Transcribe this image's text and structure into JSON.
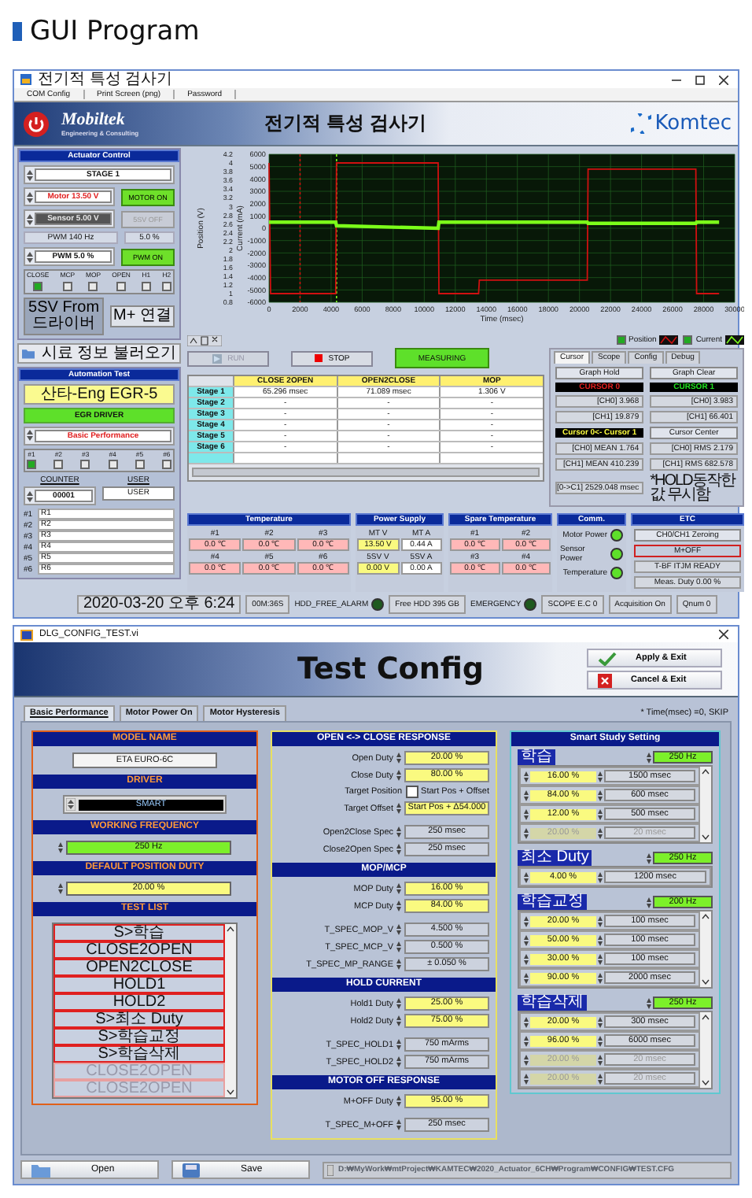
{
  "page_title": "GUI Program",
  "main_window": {
    "title": "전기적 특성 검사기",
    "menu": [
      "COM Config",
      "Print Screen (png)",
      "Password"
    ],
    "brand": {
      "name": "Mobiltek",
      "tagline": "Engineering & Consulting"
    },
    "heading": "전기적 특성 검사기",
    "partner_logo": "Komtec",
    "actuator_control": {
      "title": "Actuator Control",
      "stage": "STAGE 1",
      "switches": [
        {
          "value": "Motor 13.50 V",
          "button": "MOTOR ON",
          "on": true
        },
        {
          "value": "Sensor  5.00 V",
          "button": "5SV OFF",
          "on": false
        }
      ],
      "pwm_frequency": "PWM 140 Hz",
      "pwm_duty": "5.0 %",
      "pwm": {
        "value": "PWM 5.0 %",
        "button": "PWM ON",
        "on": true
      },
      "checks": [
        {
          "label": "CLOSE",
          "checked": true
        },
        {
          "label": "MCP",
          "checked": false
        },
        {
          "label": "MOP",
          "checked": false
        },
        {
          "label": "OPEN",
          "checked": false
        },
        {
          "label": "H1",
          "checked": false
        },
        {
          "label": "H2",
          "checked": false
        }
      ],
      "buttons": [
        "5SV From 드라이버",
        "M+ 연결"
      ]
    },
    "load_button": "시료 정보 불러오기",
    "automation_test": {
      "title": "Automation Test",
      "model": "산타-Eng EGR-5",
      "driver": "EGR DRIVER",
      "mode": "Basic Performance",
      "channels": [
        {
          "label": "#1",
          "checked": true
        },
        {
          "label": "#2",
          "checked": false
        },
        {
          "label": "#3",
          "checked": false
        },
        {
          "label": "#4",
          "checked": false
        },
        {
          "label": "#5",
          "checked": false
        },
        {
          "label": "#6",
          "checked": false
        }
      ],
      "counter": {
        "label": "COUNTER",
        "value": "00001"
      },
      "user": {
        "label": "USER",
        "value": "USER"
      },
      "results": [
        {
          "label": "#1",
          "value": "R1"
        },
        {
          "label": "#2",
          "value": "R2"
        },
        {
          "label": "#3",
          "value": "R3"
        },
        {
          "label": "#4",
          "value": "R4"
        },
        {
          "label": "#5",
          "value": "R5"
        },
        {
          "label": "#6",
          "value": "R6"
        }
      ]
    },
    "chart": {
      "position_axis": {
        "label": "Position (V)",
        "ticks": [
          "4.2",
          "4",
          "3.8",
          "3.6",
          "3.4",
          "3.2",
          "3",
          "2.8",
          "2.6",
          "2.4",
          "2.2",
          "2",
          "1.8",
          "1.6",
          "1.4",
          "1.2",
          "1",
          "0.8"
        ]
      },
      "chart_data": {
        "type": "line",
        "xlabel": "Time (msec)",
        "ylabel": "Current (mA)",
        "x": [
          0,
          100,
          4300,
          4350,
          10900,
          10950,
          13500,
          13550,
          20500,
          20550,
          27500,
          27550,
          29000
        ],
        "series": [
          {
            "name": "Position",
            "color": "#d01010",
            "values": [
              5300,
              -5300,
              -5300,
              5300,
              5300,
              -5300,
              -5300,
              -4200,
              -4200,
              4800,
              4800,
              -5300,
              -5300
            ]
          },
          {
            "name": "Current",
            "color": "#7cff1a",
            "values": [
              500,
              500,
              500,
              200,
              0,
              500,
              500,
              500,
              500,
              400,
              400,
              500,
              500
            ]
          }
        ],
        "xlim": [
          0,
          30000
        ],
        "ylim": [
          -6000,
          6000
        ],
        "xticks": [
          0,
          2000,
          4000,
          6000,
          8000,
          10000,
          12000,
          14000,
          16000,
          18000,
          20000,
          22000,
          24000,
          26000,
          28000,
          30000
        ],
        "yticks": [
          -6000,
          -5000,
          -4000,
          -3000,
          -2000,
          -1000,
          0,
          1000,
          2000,
          3000,
          4000,
          5000,
          6000
        ],
        "grid": true,
        "ref_lines": [
          {
            "axis": "x",
            "value": 2000,
            "color": "#d01010"
          },
          {
            "axis": "x",
            "value": 4350,
            "color": "#7cff1a"
          }
        ]
      },
      "legend": [
        {
          "checked": true
        },
        {
          "checked": true
        }
      ]
    },
    "controls": [
      {
        "label": "RUN",
        "kind": "run",
        "disabled": true
      },
      {
        "label": "STOP",
        "kind": "stop",
        "disabled": false
      },
      {
        "label": "MEASURING",
        "kind": "status",
        "disabled": false
      }
    ],
    "results_table": {
      "columns": [
        "CLOSE 2OPEN",
        "OPEN2CLOSE",
        "MOP"
      ],
      "rows": [
        {
          "stage": "Stage 1",
          "cells": [
            "65.296 msec",
            "71.089 msec",
            "1.306 V"
          ]
        },
        {
          "stage": "Stage 2",
          "cells": [
            "-",
            "-",
            "-"
          ]
        },
        {
          "stage": "Stage 3",
          "cells": [
            "-",
            "-",
            "-"
          ]
        },
        {
          "stage": "Stage 4",
          "cells": [
            "-",
            "-",
            "-"
          ]
        },
        {
          "stage": "Stage 5",
          "cells": [
            "-",
            "-",
            "-"
          ]
        },
        {
          "stage": "Stage 6",
          "cells": [
            "-",
            "-",
            "-"
          ]
        }
      ]
    },
    "cursor_panel": {
      "tabs": [
        {
          "label": "Cursor",
          "selected": true
        },
        {
          "label": "Scope",
          "selected": false
        },
        {
          "label": "Config",
          "selected": false
        },
        {
          "label": "Debug",
          "selected": false
        }
      ],
      "items": [
        {
          "text": "Graph Hold",
          "kind": "button"
        },
        {
          "text": "Graph Clear",
          "kind": "button"
        },
        {
          "text": "CURSOR 0",
          "kind": "cursor0"
        },
        {
          "text": "CURSOR 1",
          "kind": "cursor1"
        },
        {
          "text": "[CH0] 3.968",
          "kind": "readout"
        },
        {
          "text": "[CH0] 3.983",
          "kind": "readout"
        },
        {
          "text": "[CH1] 19.879",
          "kind": "readout"
        },
        {
          "text": "[CH1] 66.401",
          "kind": "readout"
        },
        {
          "text": "Cursor 0<- Cursor 1",
          "kind": "marker"
        },
        {
          "text": "Cursor Center",
          "kind": "button"
        },
        {
          "text": "[CH0] MEAN 1.764",
          "kind": "readout"
        },
        {
          "text": "[CH0] RMS 2.179",
          "kind": "readout"
        },
        {
          "text": "[CH1] MEAN 410.239",
          "kind": "readout"
        },
        {
          "text": "[CH1] RMS 682.578",
          "kind": "readout"
        },
        {
          "text": "[0->C1] 2529.048 msec",
          "kind": "readout"
        },
        {
          "text": "*HOLD동작한 값 무시함",
          "kind": "note"
        }
      ]
    },
    "temperature": {
      "title": "Temperature",
      "cells": [
        {
          "label": "#1",
          "value": "0.0 ℃"
        },
        {
          "label": "#2",
          "value": "0.0 ℃"
        },
        {
          "label": "#3",
          "value": "0.0 ℃"
        },
        {
          "label": "#4",
          "value": "0.0 ℃"
        },
        {
          "label": "#5",
          "value": "0.0 ℃"
        },
        {
          "label": "#6",
          "value": "0.0 ℃"
        }
      ]
    },
    "power_supply": {
      "title": "Power Supply",
      "cells": [
        {
          "label": "MT V",
          "value": "13.50 V",
          "kind": "voltage"
        },
        {
          "label": "MT A",
          "value": "0.44 A",
          "kind": "current"
        },
        {
          "label": "5SV V",
          "value": "0.00 V",
          "kind": "voltage"
        },
        {
          "label": "5SV A",
          "value": "0.00 A",
          "kind": "current"
        }
      ]
    },
    "spare_temperature": {
      "title": "Spare Temperature",
      "cells": [
        {
          "label": "#1",
          "value": "0.0 ℃"
        },
        {
          "label": "#2",
          "value": "0.0 ℃"
        },
        {
          "label": "#3",
          "value": "0.0 ℃"
        },
        {
          "label": "#4",
          "value": "0.0 ℃"
        }
      ]
    },
    "comm": {
      "title": "Comm.",
      "items": [
        {
          "label": "Motor Power",
          "on": true
        },
        {
          "label": "Sensor Power",
          "on": true
        },
        {
          "label": "Temperature",
          "on": true
        }
      ]
    },
    "etc": {
      "title": "ETC",
      "items": [
        {
          "text": "CH0/CH1 Zeroing",
          "kind": "button"
        },
        {
          "text": "M+OFF",
          "kind": "alert"
        },
        {
          "text": "T-BF ITJM READY",
          "kind": "status"
        },
        {
          "text": "Meas. Duty 0.00 %",
          "kind": "status"
        }
      ]
    },
    "status_bar": [
      {
        "text": "2020-03-20 오후 6:24",
        "kind": "field"
      },
      {
        "text": "00M:36S",
        "kind": "field"
      },
      {
        "text": "HDD_FREE_ALARM",
        "kind": "led",
        "on": false
      },
      {
        "text": "Free HDD 395 GB",
        "kind": "field"
      },
      {
        "text": "EMERGENCY",
        "kind": "led",
        "on": false
      },
      {
        "text": "SCOPE E.C 0",
        "kind": "field"
      },
      {
        "text": "Acquisition On",
        "kind": "field"
      },
      {
        "text": "Qnum 0",
        "kind": "field"
      }
    ]
  },
  "config_window": {
    "title": "DLG_CONFIG_TEST.vi",
    "heading": "Test Config",
    "actions": [
      {
        "label": "Apply & Exit",
        "kind": "apply"
      },
      {
        "label": "Cancel & Exit",
        "kind": "cancel"
      }
    ],
    "tabs": [
      {
        "label": "Basic Performance",
        "selected": true
      },
      {
        "label": "Motor Power On",
        "selected": false
      },
      {
        "label": "Motor Hysteresis",
        "selected": false
      }
    ],
    "note": "* Time(msec) =0, SKIP",
    "settings": [
      {
        "title": "MODEL NAME",
        "kind": "text",
        "value": "ETA EURO-6C"
      },
      {
        "title": "DRIVER",
        "kind": "ring",
        "value": "SMART"
      },
      {
        "title": "WORKING FREQUENCY",
        "kind": "frequency",
        "value": "250 Hz"
      },
      {
        "title": "DEFAULT POSITION DUTY",
        "kind": "duty",
        "value": "20.00 %"
      }
    ],
    "test_list": {
      "title": "TEST LIST",
      "items": [
        {
          "label": "S>학습",
          "enabled": true
        },
        {
          "label": "CLOSE2OPEN",
          "enabled": true
        },
        {
          "label": "OPEN2CLOSE",
          "enabled": true
        },
        {
          "label": "HOLD1",
          "enabled": true
        },
        {
          "label": "HOLD2",
          "enabled": true
        },
        {
          "label": "S>최소 Duty",
          "enabled": true
        },
        {
          "label": "S>학습교정",
          "enabled": true
        },
        {
          "label": "S>학습삭제",
          "enabled": true
        },
        {
          "label": "CLOSE2OPEN",
          "enabled": false
        },
        {
          "label": "CLOSE2OPEN",
          "enabled": false
        }
      ]
    },
    "response_sections": [
      {
        "title": "OPEN <-> CLOSE RESPONSE",
        "rows": [
          {
            "label": "Open Duty",
            "value": "20.00 %",
            "kind": "duty"
          },
          {
            "label": "Close Duty",
            "value": "80.00 %",
            "kind": "duty"
          },
          {
            "label": "Target Position",
            "value": "Start Pos + Offset",
            "kind": "checkbox",
            "checked": false
          },
          {
            "label": "Target Offset",
            "value": "Start Pos + Δ54.000",
            "kind": "duty"
          },
          {
            "label": "Open2Close Spec",
            "value": "250 msec",
            "kind": "spec"
          },
          {
            "label": "Close2Open Spec",
            "value": "250 msec",
            "kind": "spec"
          }
        ]
      },
      {
        "title": "MOP/MCP",
        "rows": [
          {
            "label": "MOP Duty",
            "value": "16.00 %",
            "kind": "duty"
          },
          {
            "label": "MCP Duty",
            "value": "84.00 %",
            "kind": "duty"
          },
          {
            "label": "T_SPEC_MOP_V",
            "value": "4.500 %",
            "kind": "spec"
          },
          {
            "label": "T_SPEC_MCP_V",
            "value": "0.500 %",
            "kind": "spec"
          },
          {
            "label": "T_SPEC_MP_RANGE",
            "value": "± 0.050 %",
            "kind": "spec"
          }
        ]
      },
      {
        "title": "HOLD CURRENT",
        "rows": [
          {
            "label": "Hold1 Duty",
            "value": "25.00 %",
            "kind": "duty"
          },
          {
            "label": "Hold2 Duty",
            "value": "75.00 %",
            "kind": "duty"
          },
          {
            "label": "T_SPEC_HOLD1",
            "value": "750 mArms",
            "kind": "spec"
          },
          {
            "label": "T_SPEC_HOLD2",
            "value": "750 mArms",
            "kind": "spec"
          }
        ]
      },
      {
        "title": "MOTOR OFF RESPONSE",
        "rows": [
          {
            "label": "M+OFF Duty",
            "value": "95.00 %",
            "kind": "duty"
          },
          {
            "label": "T_SPEC_M+OFF",
            "value": "250 msec",
            "kind": "spec"
          }
        ]
      }
    ],
    "smart_study": {
      "title": "Smart Study Setting",
      "groups": [
        {
          "label": "학습",
          "frequency": "250 Hz",
          "scrollbar": true,
          "rows": [
            {
              "duty": "16.00 %",
              "time": "1500 msec",
              "enabled": true
            },
            {
              "duty": "84.00 %",
              "time": "600 msec",
              "enabled": true
            },
            {
              "duty": "12.00 %",
              "time": "500 msec",
              "enabled": true
            },
            {
              "duty": "20.00 %",
              "time": "20 msec",
              "enabled": false
            }
          ]
        },
        {
          "label": "최소 Duty",
          "frequency": "250 Hz",
          "scrollbar": false,
          "rows": [
            {
              "duty": "4.00 %",
              "time": "1200 msec",
              "enabled": true
            }
          ]
        },
        {
          "label": "학습교정",
          "frequency": "200 Hz",
          "scrollbar": true,
          "rows": [
            {
              "duty": "20.00 %",
              "time": "100 msec",
              "enabled": true
            },
            {
              "duty": "50.00 %",
              "time": "100 msec",
              "enabled": true
            },
            {
              "duty": "30.00 %",
              "time": "100 msec",
              "enabled": true
            },
            {
              "duty": "90.00 %",
              "time": "2000 msec",
              "enabled": true
            }
          ]
        },
        {
          "label": "학습삭제",
          "frequency": "250 Hz",
          "scrollbar": true,
          "rows": [
            {
              "duty": "20.00 %",
              "time": "300 msec",
              "enabled": true
            },
            {
              "duty": "96.00 %",
              "time": "6000 msec",
              "enabled": true
            },
            {
              "duty": "20.00 %",
              "time": "20 msec",
              "enabled": false
            },
            {
              "duty": "20.00 %",
              "time": "20 msec",
              "enabled": false
            }
          ]
        }
      ]
    },
    "file_buttons": [
      "Open",
      "Save"
    ],
    "path": "D:₩MyWork₩mtProject₩KAMTEC₩2020_Actuator_6CH₩Program₩CONFIG₩TEST.CFG"
  }
}
